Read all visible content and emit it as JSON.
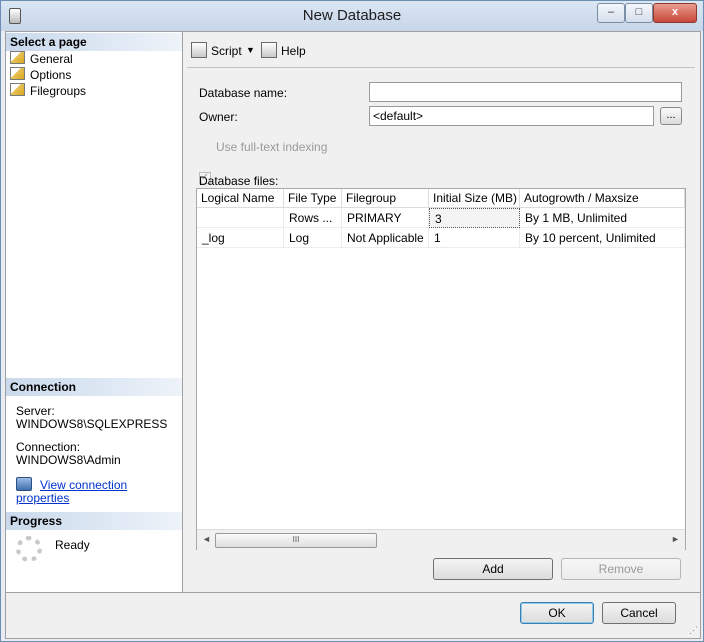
{
  "window": {
    "title": "New Database"
  },
  "sidebar": {
    "select_page_header": "Select a page",
    "pages": [
      {
        "label": "General"
      },
      {
        "label": "Options"
      },
      {
        "label": "Filegroups"
      }
    ],
    "connection_header": "Connection",
    "server_label": "Server:",
    "server_value": "WINDOWS8\\SQLEXPRESS",
    "connection_label": "Connection:",
    "connection_value": "WINDOWS8\\Admin",
    "view_connection_link": "View connection properties",
    "progress_header": "Progress",
    "progress_status": "Ready"
  },
  "toolbar": {
    "script_label": "Script",
    "help_label": "Help"
  },
  "form": {
    "database_name_label": "Database name:",
    "database_name_value": "",
    "owner_label": "Owner:",
    "owner_value": "<default>",
    "browse_label": "...",
    "fulltext_label": "Use full-text indexing",
    "database_files_label": "Database files:"
  },
  "grid": {
    "columns": [
      "Logical Name",
      "File Type",
      "Filegroup",
      "Initial Size (MB)",
      "Autogrowth / Maxsize"
    ],
    "rows": [
      [
        "",
        "Rows ...",
        "PRIMARY",
        "3",
        "By 1 MB, Unlimited"
      ],
      [
        "_log",
        "Log",
        "Not Applicable",
        "1",
        "By 10 percent, Unlimited"
      ]
    ],
    "scroll_left": "◄",
    "scroll_right": "►",
    "thumb_grip": "III"
  },
  "buttons": {
    "add": "Add",
    "remove": "Remove",
    "ok": "OK",
    "cancel": "Cancel"
  },
  "titlebar_buttons": {
    "minimize": "–",
    "maximize": "□",
    "close": "x"
  }
}
